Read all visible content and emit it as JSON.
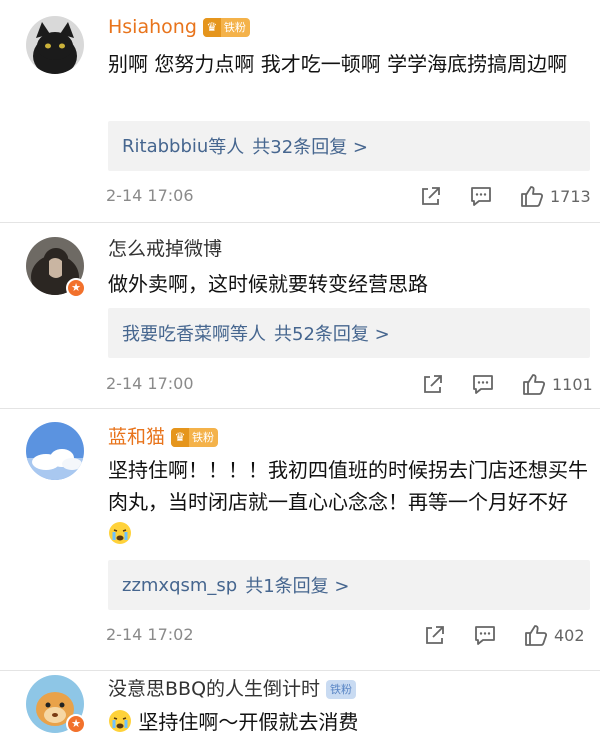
{
  "comments": [
    {
      "username": "Hsiahong",
      "fan_badge": "铁粉",
      "text": "别啊 您努力点啊 我才吃一顿啊 学学海底捞搞周边啊",
      "reply_user": "Ritabbbiu",
      "reply_suffix": "等人",
      "reply_total": "共32条回复 >",
      "time": "2-14 17:06",
      "likes": "1713"
    },
    {
      "username": "怎么戒掉微博",
      "text": "做外卖啊，这时候就要转变经营思路",
      "reply_user": "我要吃香菜啊",
      "reply_suffix": "等人",
      "reply_total": "共52条回复 >",
      "time": "2-14 17:00",
      "likes": "1101"
    },
    {
      "username": "蓝和猫",
      "fan_badge": "铁粉",
      "text": "坚持住啊！！！！我初四值班的时候拐去门店还想买牛肉丸，当时闭店就一直心心念念！再等一个月好不好",
      "reply_user": "zzmxqsm_sp",
      "reply_total": "共1条回复 >",
      "time": "2-14 17:02",
      "likes": "402"
    },
    {
      "username": "没意思BBQ的人生倒计时",
      "fan_badge": "铁粉",
      "text": "坚持住啊～开假就去消费"
    }
  ],
  "colors": {
    "orange_name": "#e8741c",
    "reply_link": "#46668f",
    "reply_bg": "#f2f2f2"
  },
  "icons": [
    "share-icon",
    "comment-icon",
    "like-icon",
    "vip-icon",
    "crying-emoji-icon"
  ]
}
